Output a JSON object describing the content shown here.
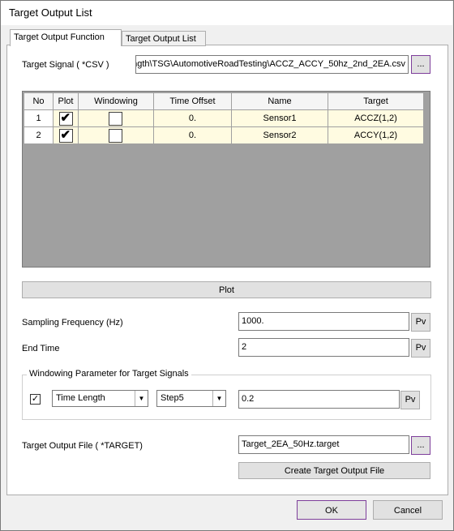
{
  "window": {
    "title": "Target Output List"
  },
  "tabs": [
    {
      "label": "Target Output Function"
    },
    {
      "label": "Target Output List"
    }
  ],
  "target_signal": {
    "label": "Target Signal ( *CSV )",
    "path": "ngth\\TSG\\AutomotiveRoadTesting\\ACCZ_ACCY_50hz_2nd_2EA.csv",
    "browse_label": "..."
  },
  "grid": {
    "columns": [
      "No",
      "Plot",
      "Windowing",
      "Time Offset",
      "Name",
      "Target"
    ],
    "rows": [
      {
        "no": "1",
        "plot": "✔",
        "windowing": "",
        "time_offset": "0.",
        "name": "Sensor1",
        "target": "ACCZ(1,2)"
      },
      {
        "no": "2",
        "plot": "✔",
        "windowing": "",
        "time_offset": "0.",
        "name": "Sensor2",
        "target": "ACCY(1,2)"
      }
    ]
  },
  "plot_button": {
    "label": "Plot"
  },
  "sampling_frequency": {
    "label": "Sampling Frequency (Hz)",
    "value": "1000.",
    "pv_label": "Pv"
  },
  "end_time": {
    "label": "End Time",
    "value": "2",
    "pv_label": "Pv"
  },
  "windowing_group": {
    "title": "Windowing Parameter for Target Signals",
    "checkbox_mark": "✓",
    "type_value": "Time Length",
    "step_value": "Step5",
    "value": "0.2",
    "pv_label": "Pv"
  },
  "target_output_file": {
    "label": "Target Output File ( *TARGET)",
    "value": "Target_2EA_50Hz.target",
    "browse_label": "...",
    "create_label": "Create Target Output File"
  },
  "footer": {
    "ok_label": "OK",
    "cancel_label": "Cancel"
  }
}
